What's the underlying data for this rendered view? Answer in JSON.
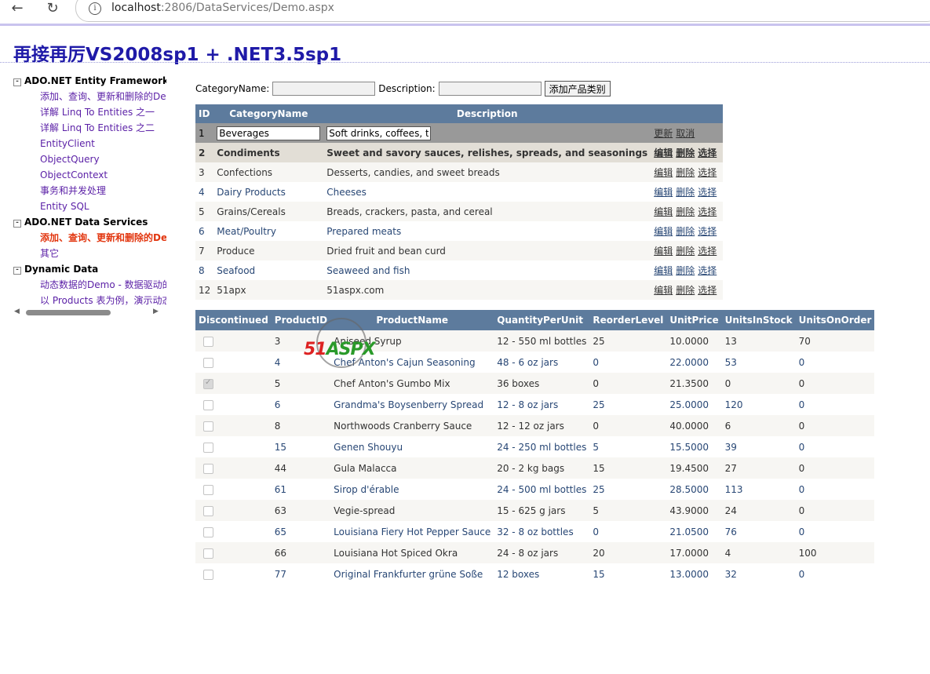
{
  "browser": {
    "url_host": "localhost",
    "url_path": ":2806/DataServices/Demo.aspx"
  },
  "page": {
    "title": "再接再厉VS2008sp1 + .NET3.5sp1"
  },
  "sidebar": {
    "groups": [
      {
        "label": "ADO.NET Entity Framework",
        "items": [
          {
            "label": "添加、查询、更新和删除的De"
          },
          {
            "label": "详解 Linq To Entities 之一"
          },
          {
            "label": "详解 Linq To Entities 之二"
          },
          {
            "label": "EntityClient"
          },
          {
            "label": "ObjectQuery"
          },
          {
            "label": "ObjectContext"
          },
          {
            "label": "事务和并发处理"
          },
          {
            "label": "Entity SQL"
          }
        ]
      },
      {
        "label": "ADO.NET Data Services",
        "items": [
          {
            "label": "添加、查询、更新和删除的De",
            "active": true
          },
          {
            "label": "其它"
          }
        ]
      },
      {
        "label": "Dynamic Data",
        "items": [
          {
            "label": "动态数据的Demo - 数据驱动的"
          },
          {
            "label": "以 Products 表为例，演示动态"
          }
        ]
      }
    ],
    "toggle_symbol": "-"
  },
  "form": {
    "category_label": "CategoryName:",
    "description_label": "Description:",
    "category_value": "",
    "description_value": "",
    "add_button": "添加产品类别"
  },
  "categories": {
    "headers": [
      "ID",
      "CategoryName",
      "Description"
    ],
    "actions": {
      "edit": "编辑",
      "delete": "删除",
      "select": "选择",
      "update": "更新",
      "cancel": "取消"
    },
    "edit_row": {
      "id": "1",
      "name": "Beverages",
      "description": "Soft drinks, coffees, teas, beers, and ales"
    },
    "rows": [
      {
        "id": "2",
        "name": "Condiments",
        "description": "Sweet and savory sauces, relishes, spreads, and seasonings"
      },
      {
        "id": "3",
        "name": "Confections",
        "description": "Desserts, candies, and sweet breads"
      },
      {
        "id": "4",
        "name": "Dairy Products",
        "description": "Cheeses"
      },
      {
        "id": "5",
        "name": "Grains/Cereals",
        "description": "Breads, crackers, pasta, and cereal"
      },
      {
        "id": "6",
        "name": "Meat/Poultry",
        "description": "Prepared meats"
      },
      {
        "id": "7",
        "name": "Produce",
        "description": "Dried fruit and bean curd"
      },
      {
        "id": "8",
        "name": "Seafood",
        "description": "Seaweed and fish"
      },
      {
        "id": "12",
        "name": "51apx",
        "description": "51aspx.com"
      }
    ]
  },
  "products": {
    "headers": [
      "Discontinued",
      "ProductID",
      "ProductName",
      "QuantityPerUnit",
      "ReorderLevel",
      "UnitPrice",
      "UnitsInStock",
      "UnitsOnOrder"
    ],
    "rows": [
      {
        "discontinued": false,
        "id": "3",
        "name": "Aniseed Syrup",
        "qty": "12 - 550 ml bottles",
        "reorder": "25",
        "price": "10.0000",
        "stock": "13",
        "order": "70"
      },
      {
        "discontinued": false,
        "id": "4",
        "name": "Chef Anton's Cajun Seasoning",
        "qty": "48 - 6 oz jars",
        "reorder": "0",
        "price": "22.0000",
        "stock": "53",
        "order": "0"
      },
      {
        "discontinued": true,
        "id": "5",
        "name": "Chef Anton's Gumbo Mix",
        "qty": "36 boxes",
        "reorder": "0",
        "price": "21.3500",
        "stock": "0",
        "order": "0"
      },
      {
        "discontinued": false,
        "id": "6",
        "name": "Grandma's Boysenberry Spread",
        "qty": "12 - 8 oz jars",
        "reorder": "25",
        "price": "25.0000",
        "stock": "120",
        "order": "0"
      },
      {
        "discontinued": false,
        "id": "8",
        "name": "Northwoods Cranberry Sauce",
        "qty": "12 - 12 oz jars",
        "reorder": "0",
        "price": "40.0000",
        "stock": "6",
        "order": "0"
      },
      {
        "discontinued": false,
        "id": "15",
        "name": "Genen Shouyu",
        "qty": "24 - 250 ml bottles",
        "reorder": "5",
        "price": "15.5000",
        "stock": "39",
        "order": "0"
      },
      {
        "discontinued": false,
        "id": "44",
        "name": "Gula Malacca",
        "qty": "20 - 2 kg bags",
        "reorder": "15",
        "price": "19.4500",
        "stock": "27",
        "order": "0"
      },
      {
        "discontinued": false,
        "id": "61",
        "name": "Sirop d'érable",
        "qty": "24 - 500 ml bottles",
        "reorder": "25",
        "price": "28.5000",
        "stock": "113",
        "order": "0"
      },
      {
        "discontinued": false,
        "id": "63",
        "name": "Vegie-spread",
        "qty": "15 - 625 g jars",
        "reorder": "5",
        "price": "43.9000",
        "stock": "24",
        "order": "0"
      },
      {
        "discontinued": false,
        "id": "65",
        "name": "Louisiana Fiery Hot Pepper Sauce",
        "qty": "32 - 8 oz bottles",
        "reorder": "0",
        "price": "21.0500",
        "stock": "76",
        "order": "0"
      },
      {
        "discontinued": false,
        "id": "66",
        "name": "Louisiana Hot Spiced Okra",
        "qty": "24 - 8 oz jars",
        "reorder": "20",
        "price": "17.0000",
        "stock": "4",
        "order": "100"
      },
      {
        "discontinued": false,
        "id": "77",
        "name": "Original Frankfurter grüne Soße",
        "qty": "12 boxes",
        "reorder": "15",
        "price": "13.0000",
        "stock": "32",
        "order": "0"
      }
    ]
  },
  "watermark": {
    "text_red": "51",
    "text_green": "ASPX"
  },
  "colors": {
    "header_bg": "#5d7b9d",
    "title": "#1f1aa8",
    "active_link": "#e2360f",
    "link": "#5a1fa6"
  }
}
